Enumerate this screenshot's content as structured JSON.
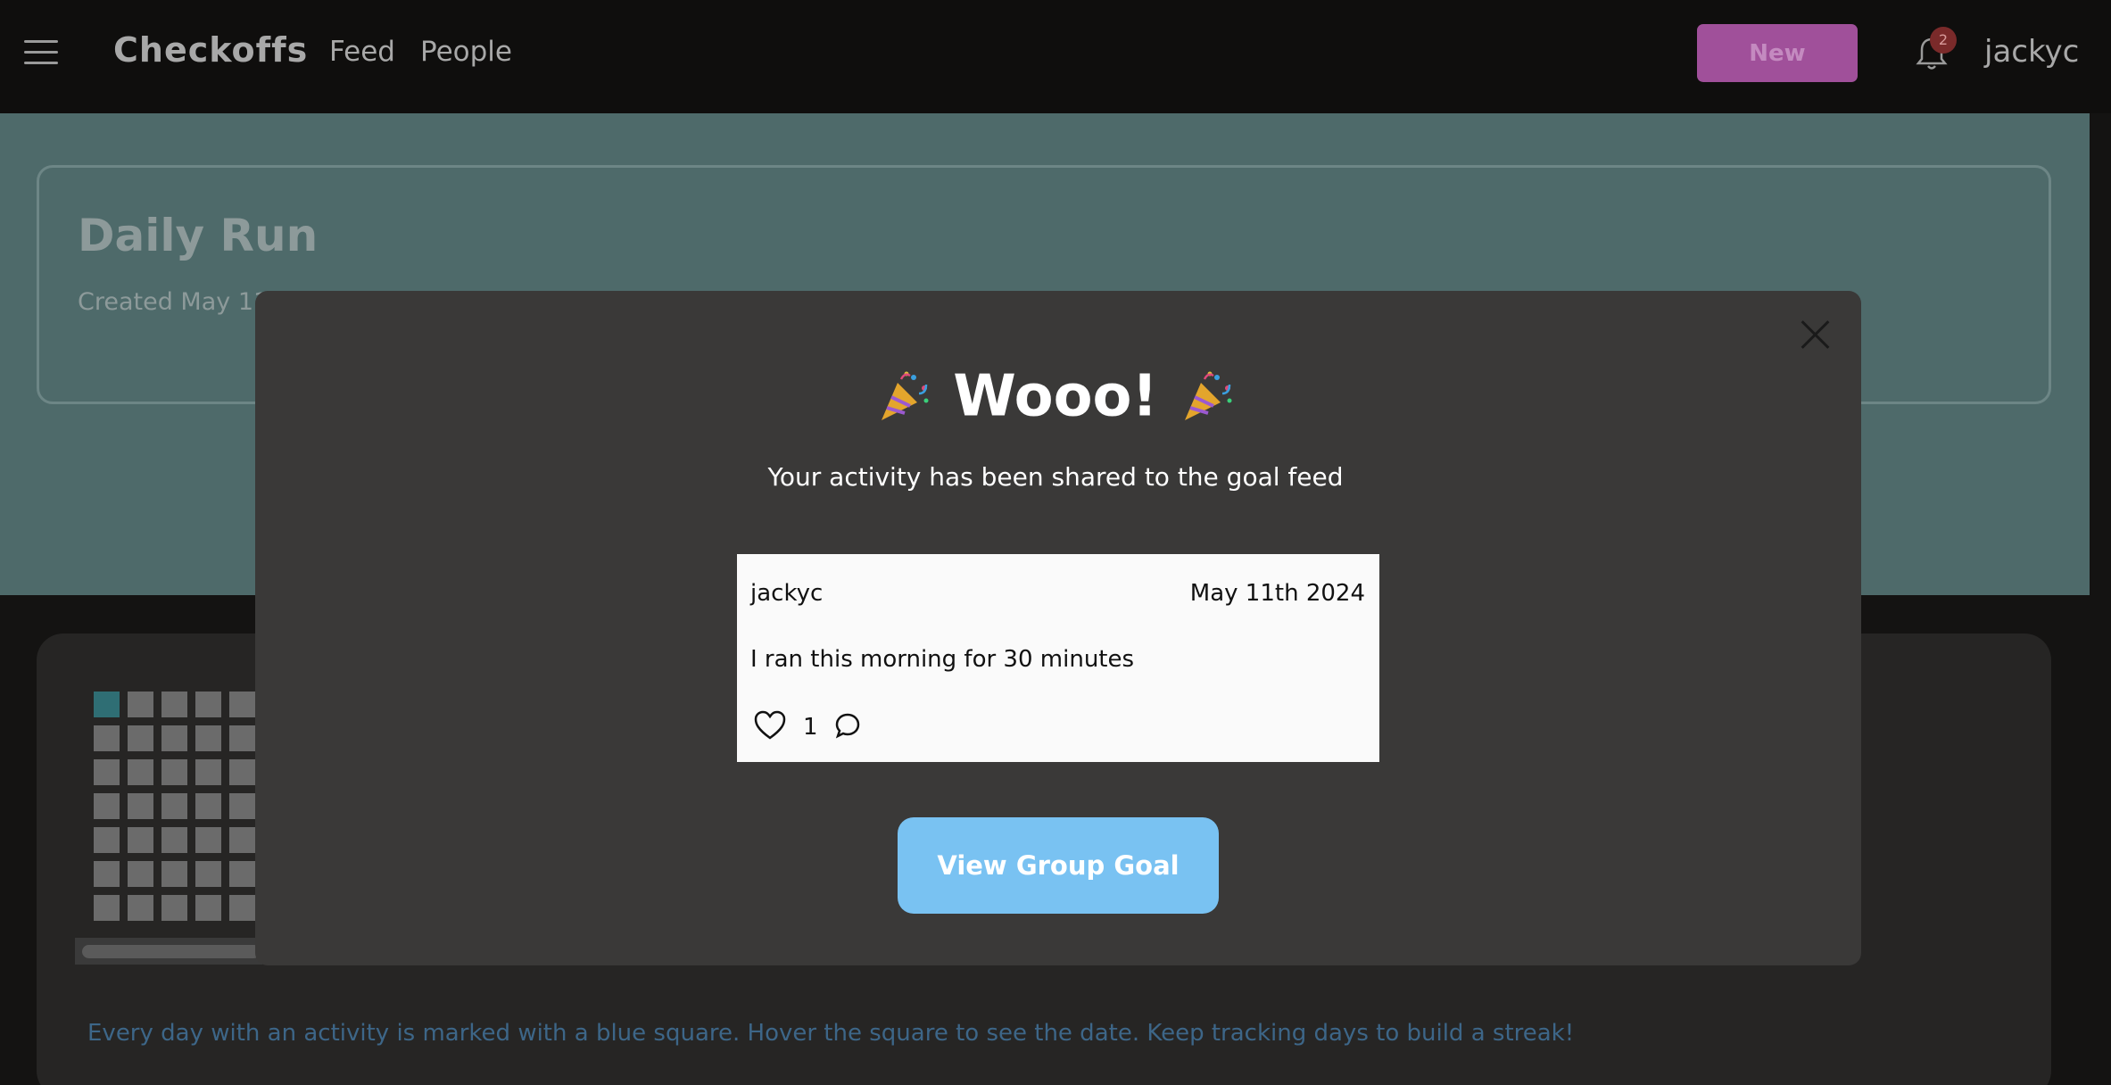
{
  "nav": {
    "brand": "Checkoffs",
    "links": [
      "Feed",
      "People"
    ],
    "new_label": "New",
    "notification_count": "2",
    "username": "jackyc"
  },
  "goal": {
    "title": "Daily Run",
    "created": "Created May 11 2"
  },
  "calendar": {
    "hint": "Every day with an activity is marked with a blue square. Hover the square to see the date. Keep tracking days to build a streak!",
    "active_color": "#2f6e74"
  },
  "modal": {
    "title": "Wooo!",
    "subtitle": "Your activity has been shared to the goal feed",
    "post": {
      "user": "jackyc",
      "date": "May 11th 2024",
      "text": "I ran this morning for 30 minutes",
      "likes": "1"
    },
    "button_label": "View Group Goal"
  },
  "colors": {
    "accent_purple": "#a0509a",
    "accent_blue": "#79c2f2",
    "teal_bg": "#4e6a6a"
  },
  "icons": [
    "menu-icon",
    "bell-icon",
    "close-icon",
    "party-popper-icon",
    "heart-icon",
    "comment-icon"
  ]
}
